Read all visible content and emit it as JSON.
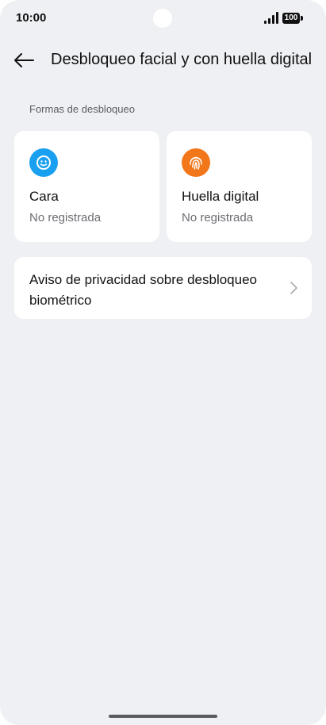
{
  "status_bar": {
    "time": "10:00",
    "battery": "100",
    "icons": [
      "signal-icon",
      "battery-icon"
    ]
  },
  "header": {
    "back_icon": "arrow-left-icon",
    "title": "Desbloqueo facial y con huella digital"
  },
  "section": {
    "label": "Formas de desbloqueo"
  },
  "methods": [
    {
      "icon": "face-icon",
      "color": "#1aa0f0",
      "title": "Cara",
      "status": "No registrada"
    },
    {
      "icon": "fingerprint-icon",
      "color": "#f2771a",
      "title": "Huella digital",
      "status": "No registrada"
    }
  ],
  "privacy": {
    "label": "Aviso de privacidad sobre desbloqueo biométrico",
    "icon": "chevron-right-icon"
  },
  "colors": {
    "background": "#eff0f3",
    "card": "#ffffff",
    "text_primary": "#111111",
    "text_secondary": "#6b6d72"
  }
}
